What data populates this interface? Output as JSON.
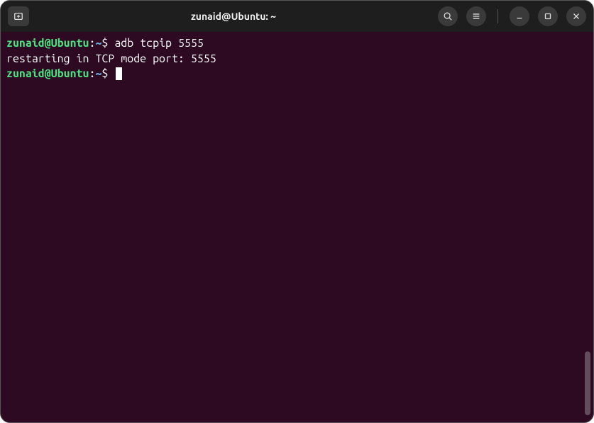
{
  "window": {
    "title": "zunaid@Ubuntu: ~"
  },
  "terminal": {
    "lines": [
      {
        "user_host": "zunaid@Ubuntu",
        "colon": ":",
        "path": "~",
        "dollar": "$ ",
        "command": "adb tcpip 5555"
      },
      {
        "output": "restarting in TCP mode port: 5555"
      },
      {
        "user_host": "zunaid@Ubuntu",
        "colon": ":",
        "path": "~",
        "dollar": "$ ",
        "command": ""
      }
    ]
  }
}
